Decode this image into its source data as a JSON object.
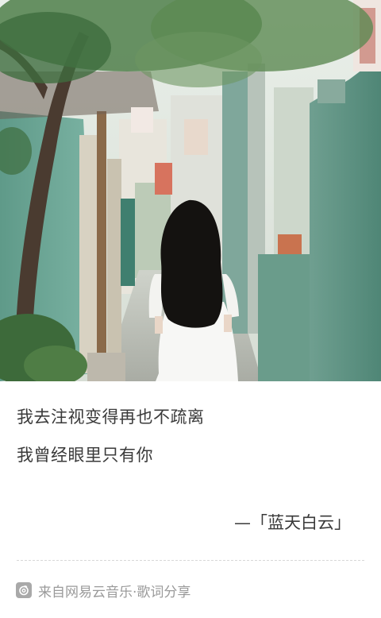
{
  "lyrics": {
    "line1": "我去注视变得再也不疏离",
    "line2": "我曾经眼里只有你"
  },
  "attribution": "—「蓝天白云」",
  "footer": {
    "icon": "netease-music-icon",
    "text": "来自网易云音乐·歌词分享"
  },
  "colors": {
    "wall_green": "#6fa596",
    "text": "#3a3a3a",
    "footer_text": "#9a9a9a"
  }
}
